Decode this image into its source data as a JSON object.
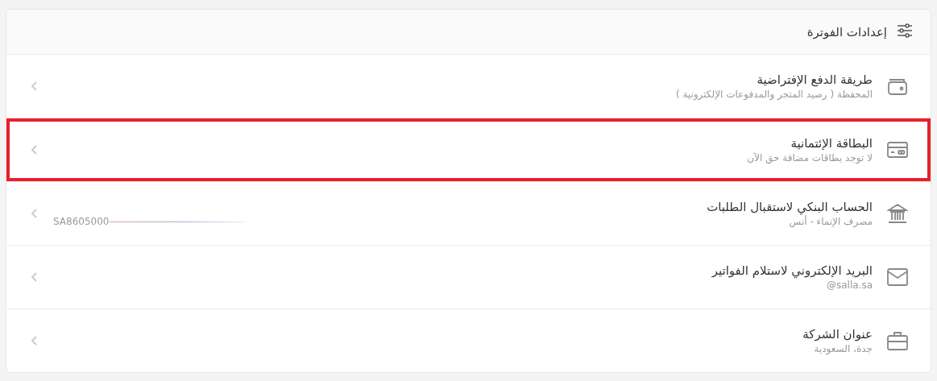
{
  "header": {
    "title": "إعدادات الفوترة"
  },
  "items": [
    {
      "title": "طريقة الدفع الإفتراضية",
      "subtitle": "المحفظة ( رصيد المتجر والمدفوعات الإلكترونية )",
      "highlighted": false
    },
    {
      "title": "البطاقة الإئتمانية",
      "subtitle": "لا توجد بطاقات مضافة حق الآن",
      "highlighted": true
    },
    {
      "title": "الحساب البنكي لاستقبال الطلبات",
      "subtitle": "مصرف الإنماء - أنس",
      "account_number": "SA8605000",
      "highlighted": false
    },
    {
      "title": "البريد الإلكتروني لاستلام الفواتير",
      "subtitle": "@salla.sa",
      "highlighted": false
    },
    {
      "title": "عنوان الشركة",
      "subtitle": "جدة، السعودية",
      "highlighted": false
    }
  ]
}
